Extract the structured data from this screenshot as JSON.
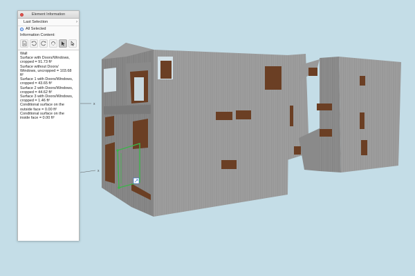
{
  "palette": {
    "title": "Element Information",
    "selection_label": "Last Selection",
    "radio_label": "All Selected",
    "section_label": "Information Content:",
    "lines": [
      "Wall",
      "Surface with Doors/Windows,",
      "cropped = 91.73 ft²",
      "Surface without Doors/",
      "Windows, uncropped = 103.68",
      "ft²",
      "Surface 1 with Doors/Windows,",
      "cropped = 43.65 ft²",
      "Surface 2 with Doors/Windows,",
      "cropped = 44.62 ft²",
      "Surface 3 with Doors/Windows,",
      "cropped = 1.46 ft²",
      "Conditional surface on the",
      "outside face = 0.00 ft²",
      "Conditional surface on the",
      "inside face = 0.00 ft²"
    ]
  },
  "axes": {
    "x1": "x",
    "x2": "x"
  },
  "colors": {
    "background": "#c4dde7",
    "selection": "#3cb54a",
    "window": "#6b3f24"
  }
}
